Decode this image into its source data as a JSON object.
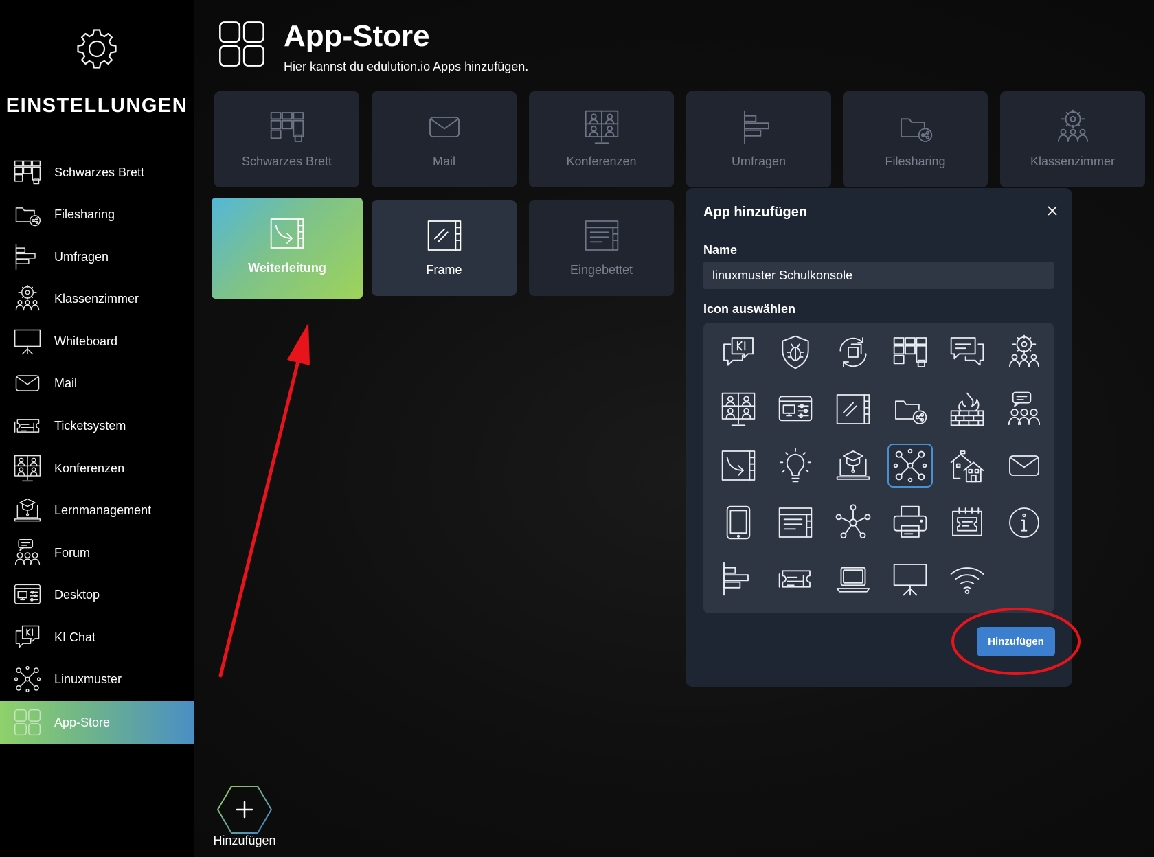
{
  "sidebar": {
    "title": "EINSTELLUNGEN",
    "items": [
      {
        "label": "Schwarzes Brett",
        "icon": "kanban-board-icon"
      },
      {
        "label": "Filesharing",
        "icon": "folder-share-icon"
      },
      {
        "label": "Umfragen",
        "icon": "bar-chart-icon"
      },
      {
        "label": "Klassenzimmer",
        "icon": "classroom-icon"
      },
      {
        "label": "Whiteboard",
        "icon": "whiteboard-icon"
      },
      {
        "label": "Mail",
        "icon": "mail-icon"
      },
      {
        "label": "Ticketsystem",
        "icon": "ticket-icon"
      },
      {
        "label": "Konferenzen",
        "icon": "conference-icon"
      },
      {
        "label": "Lernmanagement",
        "icon": "learning-management-icon"
      },
      {
        "label": "Forum",
        "icon": "forum-icon"
      },
      {
        "label": "Desktop",
        "icon": "desktop-icon"
      },
      {
        "label": "KI Chat",
        "icon": "ai-chat-icon"
      },
      {
        "label": "Linuxmuster",
        "icon": "network-icon"
      },
      {
        "label": "App-Store",
        "icon": "app-grid-icon",
        "active": true
      }
    ]
  },
  "header": {
    "title": "App-Store",
    "subtitle": "Hier kannst du edulution.io Apps hinzufügen."
  },
  "apps": [
    {
      "label": "Schwarzes Brett"
    },
    {
      "label": "Mail"
    },
    {
      "label": "Konferenzen"
    },
    {
      "label": "Umfragen"
    },
    {
      "label": "Filesharing"
    },
    {
      "label": "Klassenzimmer"
    },
    {
      "label": "Weiterleitung"
    },
    {
      "label": "Frame"
    },
    {
      "label": "Eingebettet"
    }
  ],
  "dialog": {
    "title": "App hinzufügen",
    "name_label": "Name",
    "name_value": "linuxmuster Schulkonsole",
    "icon_label": "Icon auswählen",
    "submit_label": "Hinzufügen",
    "selected_icon": "network-icon"
  },
  "footer": {
    "add_label": "Hinzufügen"
  },
  "colors": {
    "accent_blue": "#3d7fcf",
    "gradient_green": "#9ed35a",
    "annotation_red": "#e8141b"
  }
}
